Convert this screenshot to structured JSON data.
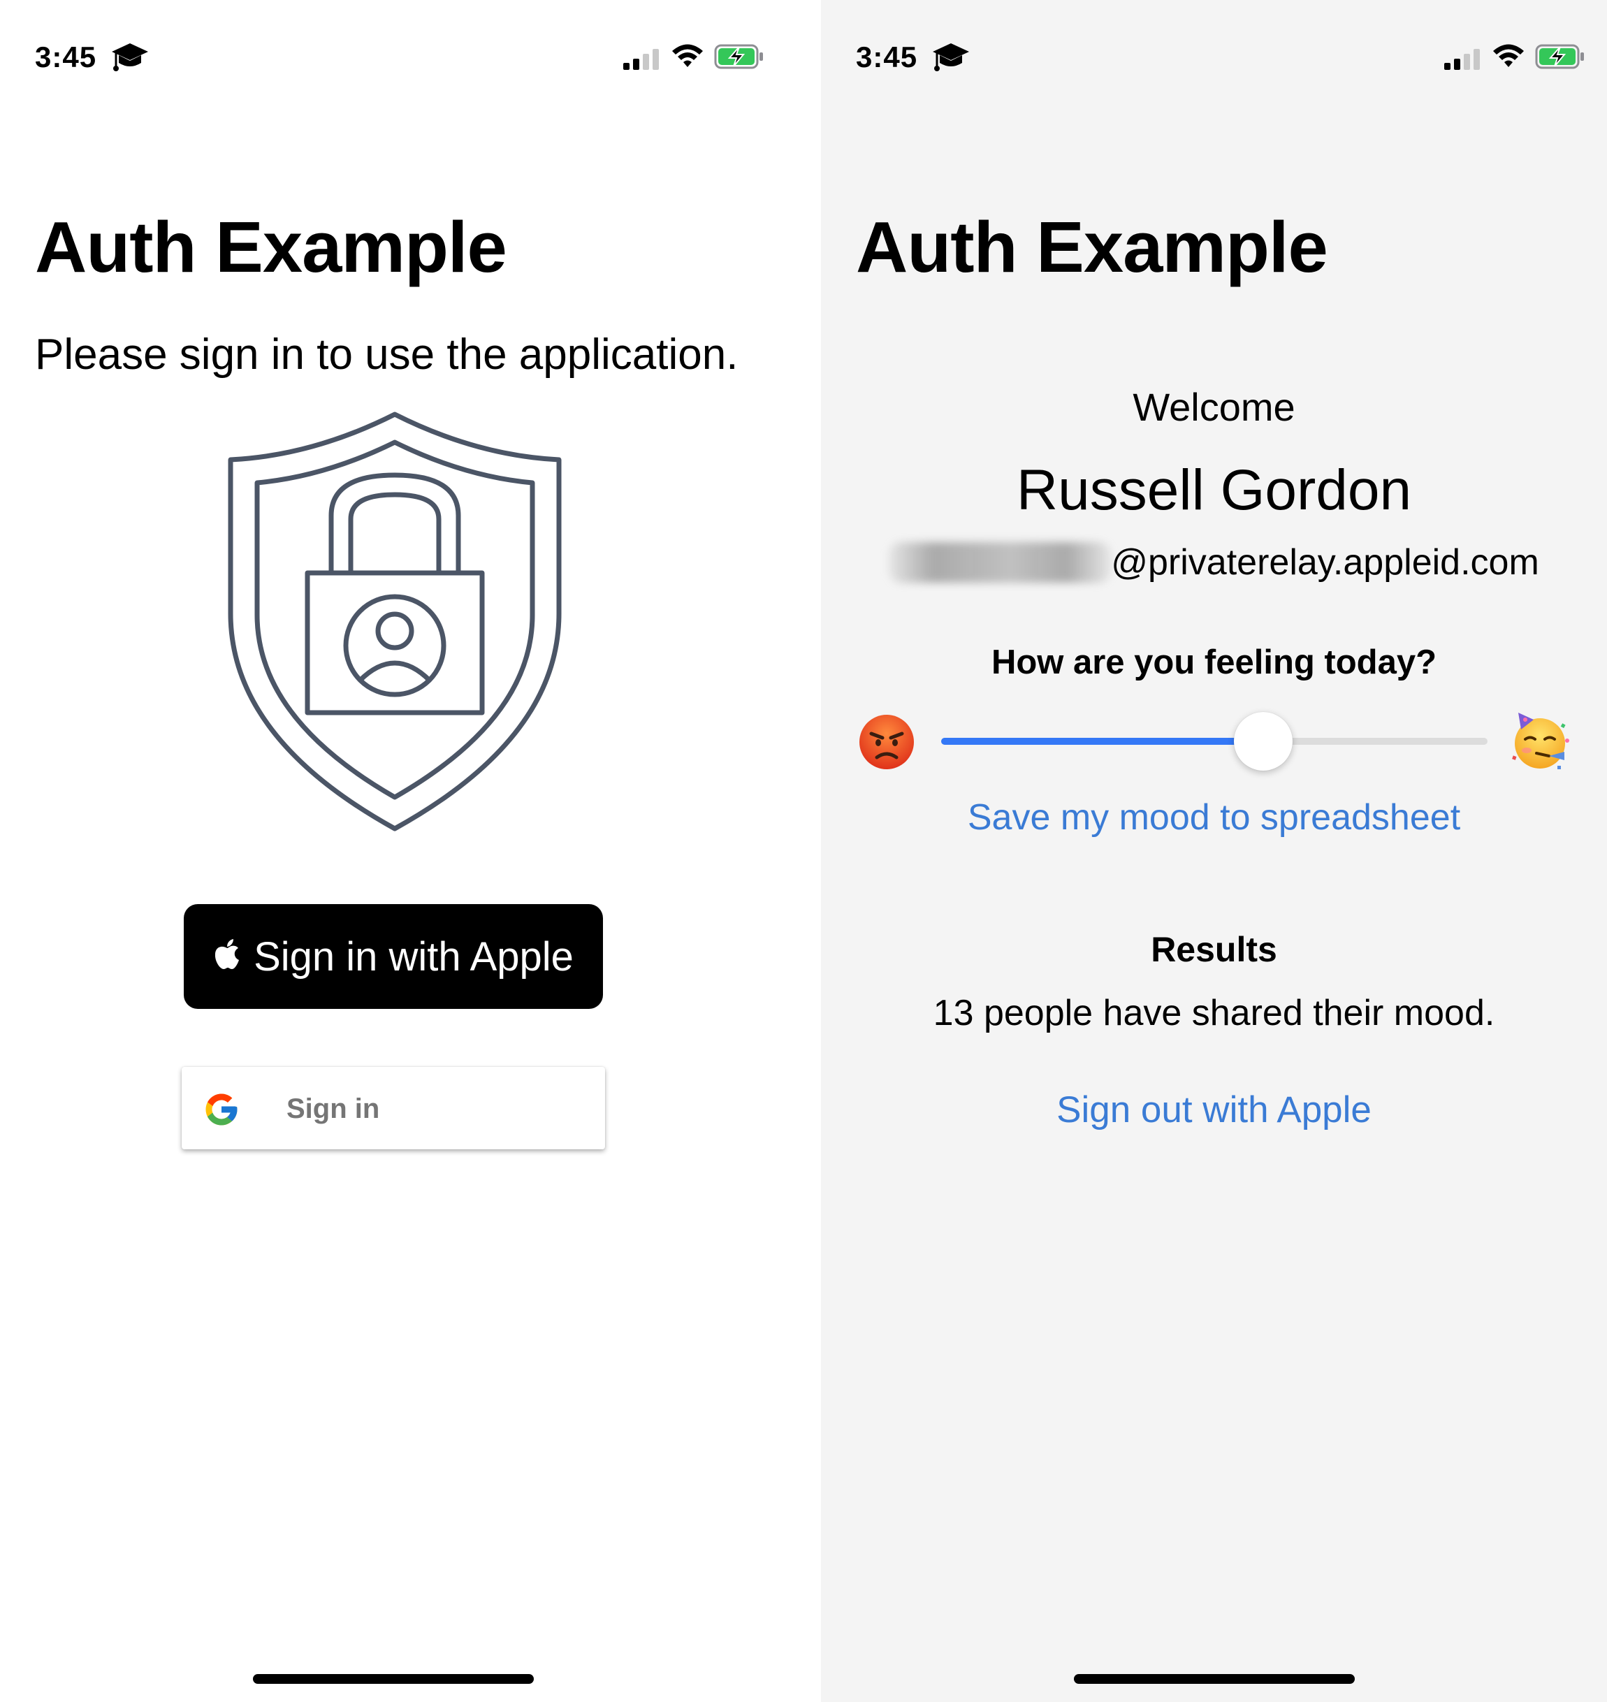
{
  "status_bar": {
    "time": "3:45"
  },
  "left_screen": {
    "title": "Auth Example",
    "subtitle": "Please sign in to use the application.",
    "apple_button_label": "Sign in with Apple",
    "google_button_label": "Sign in"
  },
  "right_screen": {
    "title": "Auth Example",
    "welcome": "Welcome",
    "user_name": "Russell Gordon",
    "email_domain": "@privaterelay.appleid.com",
    "question": "How are you feeling today?",
    "mood_slider": {
      "value": 0.59,
      "min_emoji": "angry-face",
      "max_emoji": "partying-face"
    },
    "save_link": "Save my mood to spreadsheet",
    "results_title": "Results",
    "results_text": "13 people have shared their mood.",
    "signout_link": "Sign out with Apple"
  },
  "colors": {
    "accent": "#3478f6",
    "link": "#3a7bd5",
    "shield": "#4b5566"
  }
}
